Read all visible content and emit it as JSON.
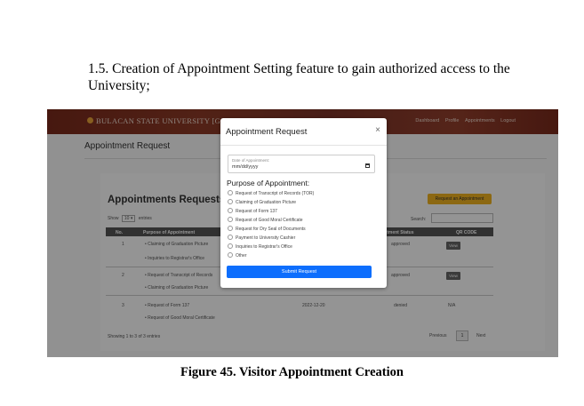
{
  "document": {
    "heading": "1.5. Creation of Appointment Setting feature to gain authorized access to the University;",
    "caption": "Figure 45. Visitor Appointment Creation"
  },
  "navbar": {
    "brand": "BULACAN STATE UNIVERSITY [GATE",
    "links": [
      "Dashboard",
      "Profile",
      "Appointments",
      "Logout"
    ]
  },
  "page": {
    "title": "Appointment Request",
    "card_title": "Appointments Requests",
    "request_button": "Request an Appointment",
    "show_label": "Show",
    "entries_value": "10",
    "entries_label": "entries",
    "search_label": "Search:",
    "columns": [
      "No.",
      "Purpose of Appointment",
      "Appointment Status",
      "QR CODE"
    ],
    "rows": [
      {
        "no": "1",
        "purposes": [
          "Claiming of Graduation Picture",
          "Inquiries to Registrar's Office"
        ],
        "date": "",
        "status": "approved",
        "qr": "View"
      },
      {
        "no": "2",
        "purposes": [
          "Request of Transcript of Records",
          "Claiming of Graduation Picture"
        ],
        "date": "",
        "status": "approved",
        "qr": "View"
      },
      {
        "no": "3",
        "purposes": [
          "Request of Form 137",
          "Request of Good Moral Certificate"
        ],
        "date": "2022-12-20",
        "status": "denied",
        "qr": "N/A"
      }
    ],
    "footer_info": "Showing 1 to 3 of 3 entries",
    "pager": {
      "previous": "Previous",
      "current": "1",
      "next": "Next"
    }
  },
  "modal": {
    "title": "Appointment Request",
    "close_symbol": "×",
    "date_label": "Date of Appointment:",
    "date_placeholder": "mm/dd/yyyy",
    "purpose_title": "Purpose of Appointment:",
    "options": [
      "Request of Transcript of Records (TOR)",
      "Claiming of Graduation Picture",
      "Request of Form 137",
      "Request of Good Moral Certificate",
      "Request for Dry Seal of Documents",
      "Payment to University Cashier",
      "Inquiries to Registrar's Office",
      "Other"
    ],
    "submit": "Submit Request"
  },
  "colors": {
    "navbar": "#7a2a1c",
    "accent_button": "#f2b41f",
    "submit": "#0d6efd"
  }
}
